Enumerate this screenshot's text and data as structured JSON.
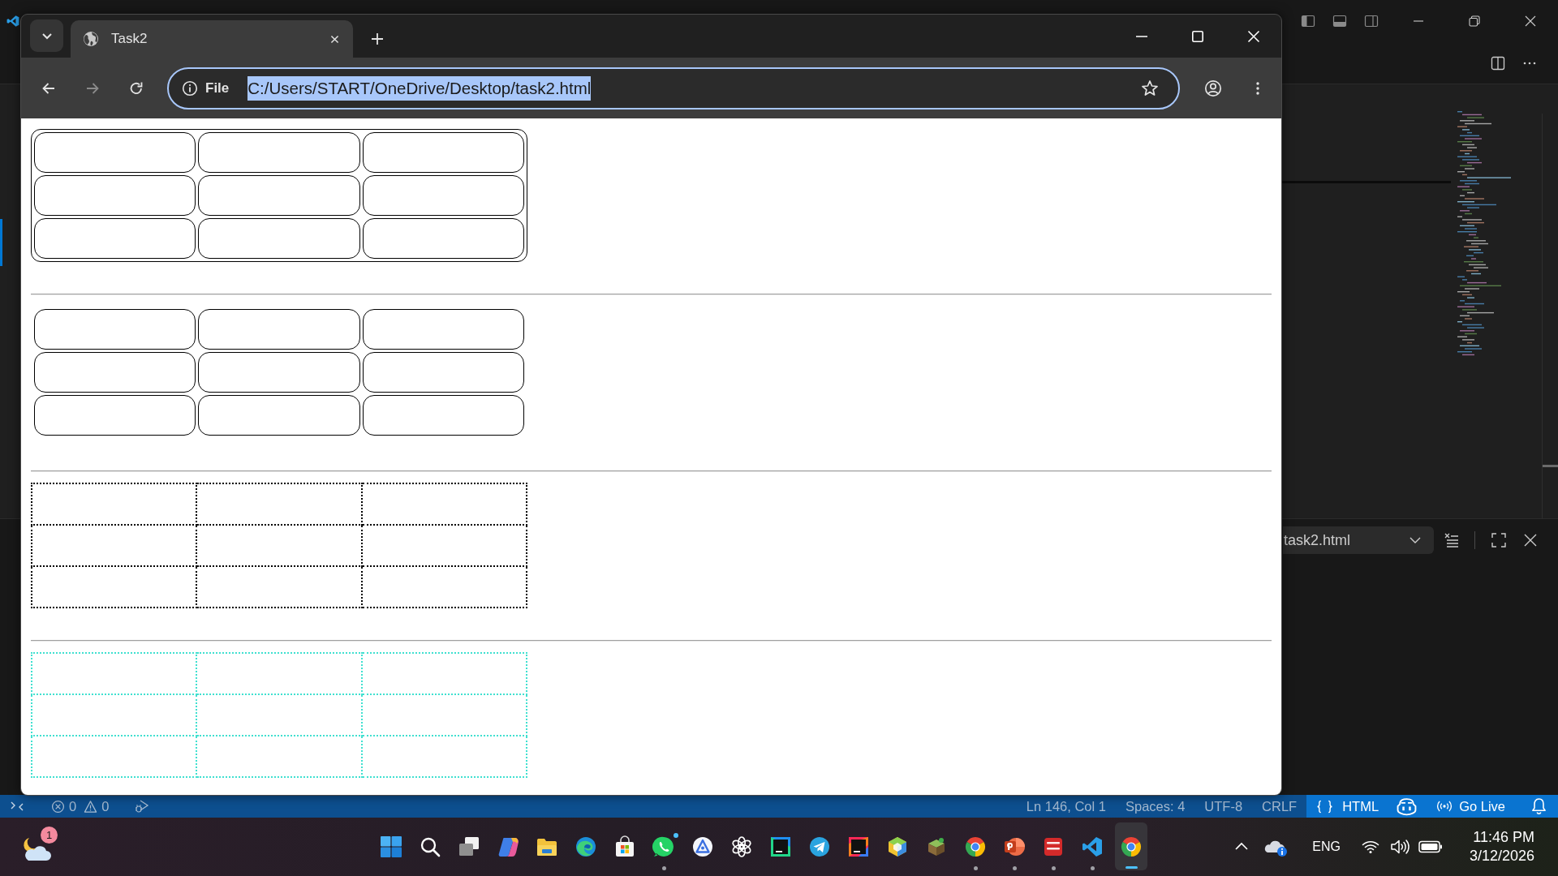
{
  "browser": {
    "tabs": [
      {
        "title": "Task2",
        "selected": true
      }
    ],
    "navigation": {
      "back_disabled": false,
      "forward_disabled": true
    },
    "address_bar": {
      "site_label": "File",
      "url": "C:/Users/START/OneDrive/Desktop/task2.html",
      "url_selected": true
    },
    "page": {
      "tables": [
        {
          "kind": "rounded",
          "framed": true,
          "color": "#000000",
          "rows": [
            [
              {},
              {},
              {}
            ],
            [
              {},
              {},
              {}
            ],
            [
              {},
              {},
              {}
            ]
          ]
        },
        {
          "kind": "rounded",
          "framed": false,
          "color": "#000000",
          "rows": [
            [
              {},
              {},
              {}
            ],
            [
              {},
              {},
              {}
            ],
            [
              {},
              {},
              {}
            ]
          ]
        },
        {
          "kind": "dotted",
          "color": "#000000",
          "rows": [
            [
              {},
              {},
              {}
            ],
            [
              {},
              {},
              {}
            ],
            [
              {},
              {},
              {}
            ]
          ]
        },
        {
          "kind": "dotted",
          "color": "#40e0d0",
          "rows": [
            [
              {},
              {},
              {}
            ],
            [
              {},
              {},
              {}
            ],
            [
              {},
              {},
              {}
            ]
          ]
        }
      ]
    }
  },
  "vscode": {
    "panel": {
      "terminal_dropdown": "task2.html"
    },
    "status_bar": {
      "errors": "0",
      "warnings": "0",
      "cursor": "Ln 146, Col 1",
      "indentation": "Spaces: 4",
      "encoding": "UTF-8",
      "line_ending": "CRLF",
      "language": "HTML",
      "live_server": "Go Live"
    }
  },
  "taskbar": {
    "weather_badge": "1",
    "apps": [
      {
        "running": false,
        "selected": false,
        "notified": false
      },
      {
        "running": false,
        "selected": false,
        "notified": false
      },
      {
        "running": false,
        "selected": false,
        "notified": false
      },
      {
        "running": false,
        "selected": false,
        "notified": false
      },
      {
        "running": false,
        "selected": false,
        "notified": false
      },
      {
        "running": false,
        "selected": false,
        "notified": false
      },
      {
        "running": false,
        "selected": false,
        "notified": false
      },
      {
        "running": true,
        "selected": false,
        "notified": true
      },
      {
        "running": false,
        "selected": false,
        "notified": false
      },
      {
        "running": false,
        "selected": false,
        "notified": false
      },
      {
        "running": false,
        "selected": false,
        "notified": false
      },
      {
        "running": false,
        "selected": false,
        "notified": false
      },
      {
        "running": false,
        "selected": false,
        "notified": false
      },
      {
        "running": false,
        "selected": false,
        "notified": false
      },
      {
        "running": false,
        "selected": false,
        "notified": false
      },
      {
        "running": true,
        "selected": false,
        "notified": false
      },
      {
        "running": true,
        "selected": false,
        "notified": false
      },
      {
        "running": true,
        "selected": false,
        "notified": false
      },
      {
        "running": true,
        "selected": false,
        "notified": false
      },
      {
        "running": true,
        "selected": true,
        "notified": false
      }
    ],
    "language": "ENG",
    "time": "11:46 PM",
    "date": "3/12/2026"
  }
}
